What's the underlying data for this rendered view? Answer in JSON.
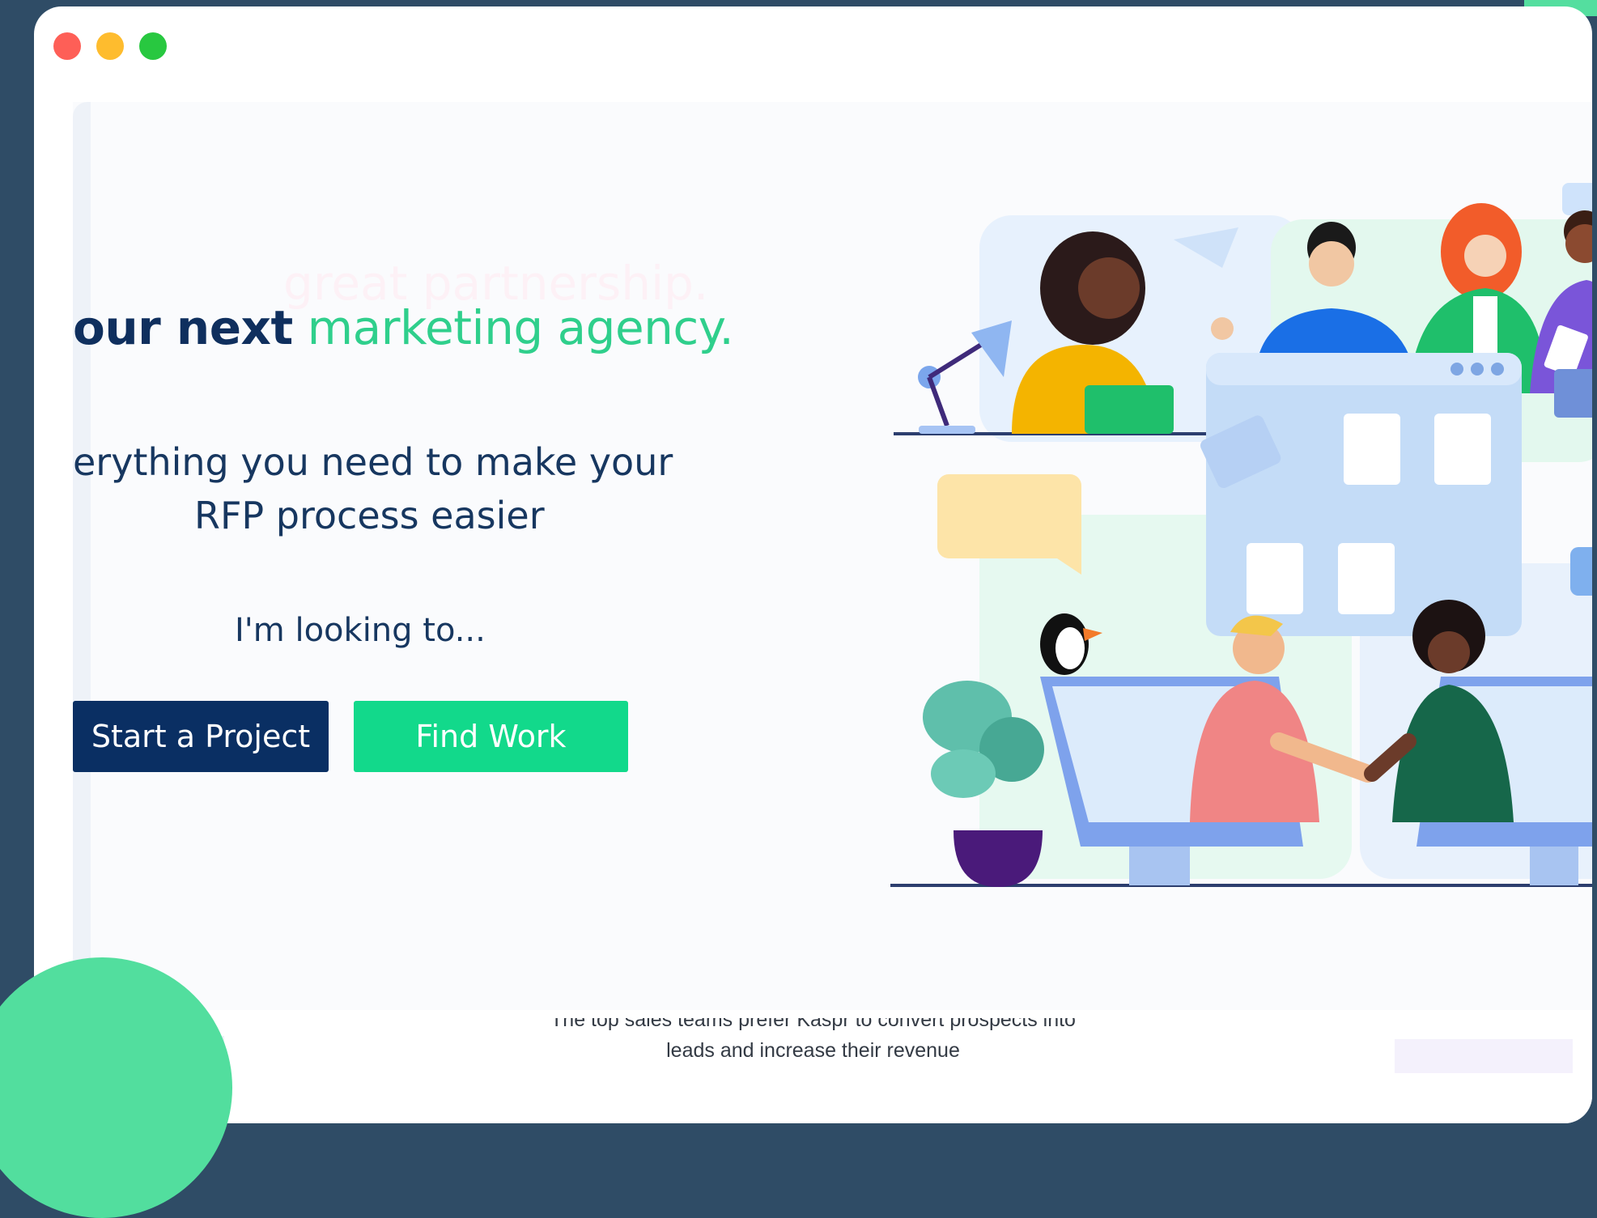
{
  "window": {
    "controls": [
      "close",
      "minimize",
      "maximize"
    ]
  },
  "hero": {
    "faded_text": "great partnership.",
    "headline_dark": "our next",
    "headline_green": "marketing agency.",
    "subtitle_line1": "erything you need to make your",
    "subtitle_line2": "RFP process easier",
    "prompt": "I'm looking to...",
    "buttons": {
      "start_project": "Start a Project",
      "find_work": "Find Work"
    }
  },
  "footer": {
    "line1": "The top sales teams prefer Kaspr to convert prospects into",
    "line2": "leads and increase their revenue"
  },
  "colors": {
    "background": "#2f4c66",
    "navy": "#0a2f63",
    "green": "#12d98b",
    "headline_green": "#2fcf8c",
    "blob": "#52de9e"
  },
  "illustration": "team-collaboration-handshake-illustration"
}
